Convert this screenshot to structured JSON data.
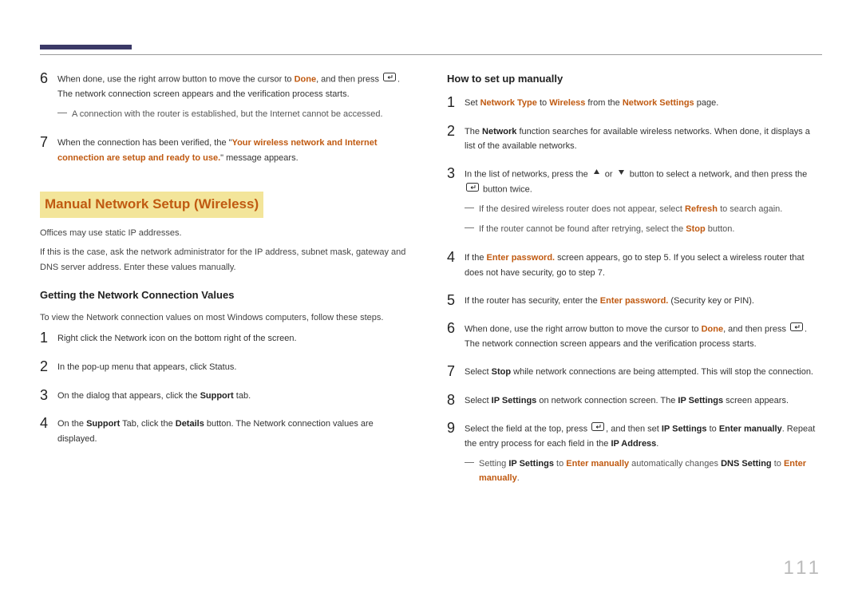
{
  "left": {
    "step6_a": "When done, use the right arrow button to move the cursor to ",
    "step6_done": "Done",
    "step6_b": ", and then press ",
    "step6_c": ". The network connection screen appears and the verification process starts.",
    "note6": "A connection with the router is established, but the Internet cannot be accessed.",
    "step7_a": "When the connection has been verified, the \"",
    "step7_msg": "Your wireless network and Internet connection are setup and ready to use.",
    "step7_b": "\" message appears.",
    "section": "Manual Network Setup (Wireless)",
    "para1": "Offices may use static IP addresses.",
    "para2": "If this is the case, ask the network administrator for the IP address, subnet mask, gateway and DNS server address. Enter these values manually.",
    "sub1": "Getting the Network Connection Values",
    "intro1": "To view the Network connection values on most Windows computers, follow these steps.",
    "g1": "Right click the Network icon on the bottom right of the screen.",
    "g2": "In the pop-up menu that appears, click Status.",
    "g3_a": "On the dialog that appears, click the ",
    "g3_b": "Support",
    "g3_c": " tab.",
    "g4_a": "On the ",
    "g4_b": "Support",
    "g4_c": " Tab, click the ",
    "g4_d": "Details",
    "g4_e": " button. The Network connection values are displayed."
  },
  "right": {
    "sub": "How to set up manually",
    "s1_a": "Set ",
    "s1_b": "Network Type",
    "s1_c": " to ",
    "s1_d": "Wireless",
    "s1_e": " from the ",
    "s1_f": "Network Settings",
    "s1_g": " page.",
    "s2_a": "The ",
    "s2_b": "Network",
    "s2_c": " function searches for available wireless networks. When done, it displays a list of the available networks.",
    "s3_a": "In the list of networks, press the ",
    "s3_b": " or ",
    "s3_c": " button to select a network, and then press the ",
    "s3_d": " button twice.",
    "n3a_a": "If the desired wireless router does not appear, select ",
    "n3a_b": "Refresh",
    "n3a_c": " to search again.",
    "n3b_a": "If the router cannot be found after retrying, select the ",
    "n3b_b": "Stop",
    "n3b_c": " button.",
    "s4_a": "If the ",
    "s4_b": "Enter password.",
    "s4_c": " screen appears, go to step 5. If you select a wireless router that does not have security, go to step 7.",
    "s5_a": "If the router has security, enter the ",
    "s5_b": "Enter password.",
    "s5_c": " (Security key or PIN).",
    "s6_a": "When done, use the right arrow button to move the cursor to ",
    "s6_b": "Done",
    "s6_c": ", and then press ",
    "s6_d": ". The network connection screen appears and the verification process starts.",
    "s7_a": "Select ",
    "s7_b": "Stop",
    "s7_c": " while network connections are being attempted. This will stop the connection.",
    "s8_a": "Select ",
    "s8_b": "IP Settings",
    "s8_c": " on network connection screen. The ",
    "s8_d": "IP Settings",
    "s8_e": " screen appears.",
    "s9_a": "Select the field at the top, press ",
    "s9_b": ", and then set ",
    "s9_c": "IP Settings",
    "s9_d": " to ",
    "s9_e": "Enter manually",
    "s9_f": ". Repeat the entry process for each field in the ",
    "s9_g": "IP Address",
    "s9_h": ".",
    "n9_a": "Setting ",
    "n9_b": "IP Settings",
    "n9_c": " to ",
    "n9_d": "Enter manually",
    "n9_e": " automatically changes ",
    "n9_f": "DNS Setting",
    "n9_g": " to ",
    "n9_h": "Enter manually",
    "n9_i": "."
  },
  "page": "111"
}
